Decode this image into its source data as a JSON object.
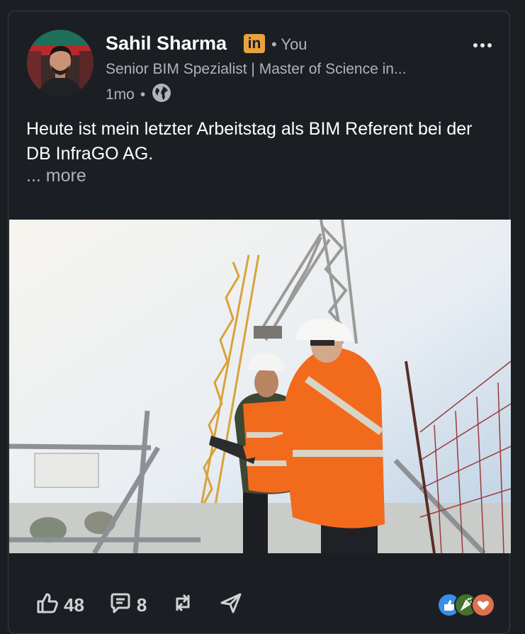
{
  "post": {
    "author_name": "Sahil Sharma",
    "author_badge": "in",
    "relation": "• You",
    "author_headline": "Senior BIM Spezialist | Master of Science in...",
    "age": "1mo",
    "age_separator": "•",
    "visibility_icon": "globe-icon",
    "text": "Heute ist mein letzter Arbeitstag als BIM Referent bei der DB InfraGO AG.",
    "more_label": "... more",
    "image_icon": "construction-photo",
    "menu_icon": "more-horizontal-icon"
  },
  "actions": {
    "like_icon": "thumbs-up-icon",
    "like_count": "48",
    "comment_icon": "comment-icon",
    "comment_count": "8",
    "repost_icon": "repost-icon",
    "send_icon": "send-icon"
  },
  "reactions": {
    "icons": [
      "like-reaction-icon",
      "celebrate-reaction-icon",
      "love-reaction-icon"
    ]
  },
  "colors": {
    "background": "#1b1f23",
    "border": "#3a3f45",
    "secondary_text": "#b0b3b8",
    "linkedin_badge": "#e7a33e",
    "vest_orange": "#f26a1b"
  }
}
